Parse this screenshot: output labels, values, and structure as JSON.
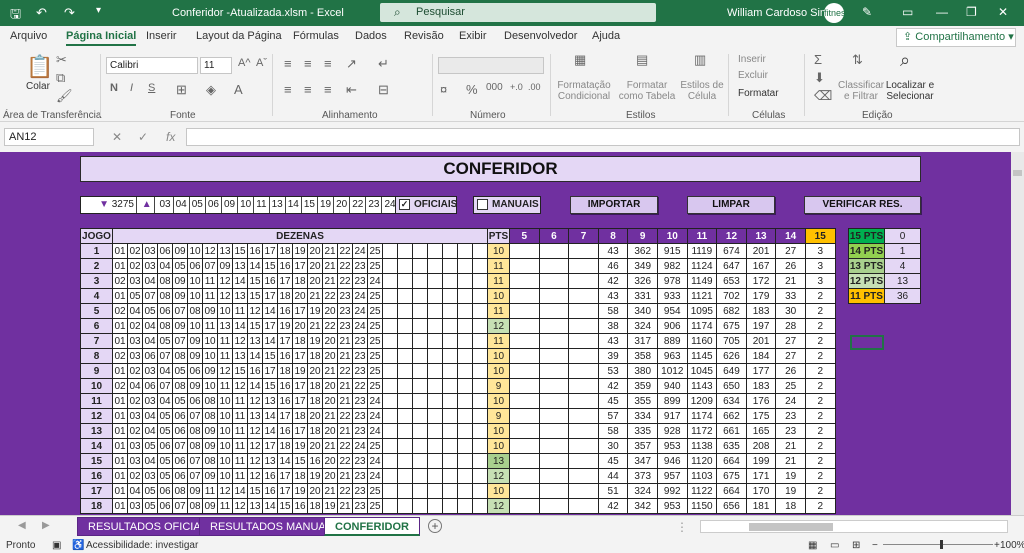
{
  "titlebar": {
    "file_title": "Conferidor -Atualizada.xlsm  -  Excel",
    "search_placeholder": "Pesquisar",
    "user_name": "William Cardoso Simas",
    "avatar_text": "fitness"
  },
  "menu": {
    "items": [
      "Arquivo",
      "Página Inicial",
      "Inserir",
      "Layout da Página",
      "Fórmulas",
      "Dados",
      "Revisão",
      "Exibir",
      "Desenvolvedor",
      "Ajuda"
    ],
    "share": "Compartilhamento"
  },
  "ribbon": {
    "paste_label": "Colar",
    "clipboard_group": "Área de Transferência",
    "font_name": "Calibri",
    "font_size": "11",
    "font_group": "Fonte",
    "bold": "N",
    "italic": "I",
    "underline": "S",
    "align_group": "Alinhamento",
    "number_group": "Número",
    "cond_format": "Formatação Condicional",
    "format_table": "Formatar como Tabela",
    "cell_styles": "Estilos de Célula",
    "styles_group": "Estilos",
    "insert": "Inserir",
    "delete": "Excluir",
    "format": "Formatar",
    "cells_group": "Células",
    "sort_filter": "Classificar e Filtrar",
    "find_select": "Localizar e Selecionar",
    "edit_group": "Edição"
  },
  "formula_bar": {
    "name_box": "AN12",
    "fx": "fx",
    "formula": ""
  },
  "sheet": {
    "banner": "CONFERIDOR",
    "draw_number": "3275",
    "draw_numbers": [
      "03",
      "04",
      "05",
      "06",
      "09",
      "10",
      "11",
      "13",
      "14",
      "15",
      "19",
      "20",
      "22",
      "23",
      "24"
    ],
    "chk_oficiais": "OFICIAIS",
    "chk_manuais": "MANUAIS",
    "btn_importar": "IMPORTAR",
    "btn_limpar": "LIMPAR",
    "btn_verificar": "VERIFICAR RES.",
    "headers": {
      "jogo": "JOGO",
      "dezenas": "DEZENAS",
      "pts": "PTS",
      "cols": [
        "5",
        "6",
        "7",
        "8",
        "9",
        "10",
        "11",
        "12",
        "13",
        "14",
        "15"
      ]
    },
    "rows": [
      {
        "jogo": "1",
        "d": [
          "01",
          "02",
          "03",
          "06",
          "09",
          "10",
          "12",
          "13",
          "15",
          "16",
          "17",
          "18",
          "19",
          "20",
          "21",
          "22",
          "24",
          "25"
        ],
        "pts": "10",
        "c": [
          "",
          "",
          "",
          "43",
          "362",
          "915",
          "1119",
          "674",
          "201",
          "27",
          "3"
        ]
      },
      {
        "jogo": "2",
        "d": [
          "01",
          "02",
          "03",
          "04",
          "05",
          "06",
          "07",
          "09",
          "13",
          "14",
          "15",
          "16",
          "17",
          "20",
          "21",
          "22",
          "23",
          "25"
        ],
        "pts": "11",
        "c": [
          "",
          "",
          "",
          "46",
          "349",
          "982",
          "1124",
          "647",
          "167",
          "26",
          "3"
        ]
      },
      {
        "jogo": "3",
        "d": [
          "02",
          "03",
          "04",
          "08",
          "09",
          "10",
          "11",
          "12",
          "14",
          "15",
          "16",
          "17",
          "18",
          "20",
          "21",
          "22",
          "23",
          "24"
        ],
        "pts": "11",
        "c": [
          "",
          "",
          "",
          "42",
          "326",
          "978",
          "1149",
          "653",
          "172",
          "21",
          "3"
        ]
      },
      {
        "jogo": "4",
        "d": [
          "01",
          "05",
          "07",
          "08",
          "09",
          "10",
          "11",
          "12",
          "13",
          "15",
          "17",
          "18",
          "20",
          "21",
          "22",
          "23",
          "24",
          "25"
        ],
        "pts": "10",
        "c": [
          "",
          "",
          "",
          "43",
          "331",
          "933",
          "1121",
          "702",
          "179",
          "33",
          "2"
        ]
      },
      {
        "jogo": "5",
        "d": [
          "02",
          "04",
          "05",
          "06",
          "07",
          "08",
          "09",
          "10",
          "11",
          "12",
          "14",
          "16",
          "17",
          "19",
          "20",
          "23",
          "24",
          "25"
        ],
        "pts": "11",
        "c": [
          "",
          "",
          "",
          "58",
          "340",
          "954",
          "1095",
          "682",
          "183",
          "30",
          "2"
        ]
      },
      {
        "jogo": "6",
        "d": [
          "01",
          "02",
          "04",
          "08",
          "09",
          "10",
          "11",
          "13",
          "14",
          "15",
          "17",
          "19",
          "20",
          "21",
          "22",
          "23",
          "24",
          "25"
        ],
        "pts": "12",
        "c": [
          "",
          "",
          "",
          "38",
          "324",
          "906",
          "1174",
          "675",
          "197",
          "28",
          "2"
        ]
      },
      {
        "jogo": "7",
        "d": [
          "01",
          "03",
          "04",
          "05",
          "07",
          "09",
          "10",
          "11",
          "12",
          "13",
          "14",
          "17",
          "18",
          "19",
          "20",
          "21",
          "23",
          "25"
        ],
        "pts": "11",
        "c": [
          "",
          "",
          "",
          "43",
          "317",
          "889",
          "1160",
          "705",
          "201",
          "27",
          "2"
        ]
      },
      {
        "jogo": "8",
        "d": [
          "02",
          "03",
          "06",
          "07",
          "08",
          "09",
          "10",
          "11",
          "13",
          "14",
          "15",
          "16",
          "17",
          "18",
          "20",
          "21",
          "23",
          "25"
        ],
        "pts": "10",
        "c": [
          "",
          "",
          "",
          "39",
          "358",
          "963",
          "1145",
          "626",
          "184",
          "27",
          "2"
        ]
      },
      {
        "jogo": "9",
        "d": [
          "01",
          "02",
          "03",
          "04",
          "05",
          "06",
          "09",
          "12",
          "15",
          "16",
          "17",
          "18",
          "19",
          "20",
          "21",
          "22",
          "23",
          "25"
        ],
        "pts": "10",
        "c": [
          "",
          "",
          "",
          "53",
          "380",
          "1012",
          "1045",
          "649",
          "177",
          "26",
          "2"
        ]
      },
      {
        "jogo": "10",
        "d": [
          "02",
          "04",
          "06",
          "07",
          "08",
          "09",
          "10",
          "11",
          "12",
          "14",
          "15",
          "16",
          "17",
          "18",
          "20",
          "21",
          "22",
          "25"
        ],
        "pts": "9",
        "c": [
          "",
          "",
          "",
          "42",
          "359",
          "940",
          "1143",
          "650",
          "183",
          "25",
          "2"
        ]
      },
      {
        "jogo": "11",
        "d": [
          "01",
          "02",
          "03",
          "04",
          "05",
          "06",
          "08",
          "10",
          "11",
          "12",
          "13",
          "16",
          "17",
          "18",
          "20",
          "21",
          "23",
          "24"
        ],
        "pts": "10",
        "c": [
          "",
          "",
          "",
          "45",
          "355",
          "899",
          "1209",
          "634",
          "176",
          "24",
          "2"
        ]
      },
      {
        "jogo": "12",
        "d": [
          "01",
          "03",
          "04",
          "05",
          "06",
          "07",
          "08",
          "10",
          "11",
          "13",
          "14",
          "17",
          "18",
          "20",
          "21",
          "22",
          "23",
          "24"
        ],
        "pts": "9",
        "c": [
          "",
          "",
          "",
          "57",
          "334",
          "917",
          "1174",
          "662",
          "175",
          "23",
          "2"
        ]
      },
      {
        "jogo": "13",
        "d": [
          "01",
          "02",
          "04",
          "05",
          "06",
          "08",
          "09",
          "10",
          "11",
          "12",
          "14",
          "16",
          "17",
          "18",
          "20",
          "21",
          "23",
          "24"
        ],
        "pts": "10",
        "c": [
          "",
          "",
          "",
          "58",
          "335",
          "928",
          "1172",
          "661",
          "165",
          "23",
          "2"
        ]
      },
      {
        "jogo": "14",
        "d": [
          "01",
          "03",
          "05",
          "06",
          "07",
          "08",
          "09",
          "10",
          "11",
          "12",
          "17",
          "18",
          "19",
          "20",
          "21",
          "22",
          "24",
          "25"
        ],
        "pts": "10",
        "c": [
          "",
          "",
          "",
          "30",
          "357",
          "953",
          "1138",
          "635",
          "208",
          "21",
          "2"
        ]
      },
      {
        "jogo": "15",
        "d": [
          "01",
          "03",
          "04",
          "05",
          "06",
          "07",
          "08",
          "10",
          "11",
          "12",
          "13",
          "14",
          "15",
          "16",
          "20",
          "22",
          "23",
          "24"
        ],
        "pts": "13",
        "c": [
          "",
          "",
          "",
          "45",
          "347",
          "946",
          "1120",
          "664",
          "199",
          "21",
          "2"
        ]
      },
      {
        "jogo": "16",
        "d": [
          "01",
          "02",
          "03",
          "05",
          "06",
          "07",
          "09",
          "10",
          "11",
          "12",
          "16",
          "17",
          "18",
          "19",
          "20",
          "21",
          "23",
          "24"
        ],
        "pts": "12",
        "c": [
          "",
          "",
          "",
          "44",
          "373",
          "957",
          "1103",
          "675",
          "171",
          "19",
          "2"
        ]
      },
      {
        "jogo": "17",
        "d": [
          "01",
          "04",
          "05",
          "06",
          "08",
          "09",
          "11",
          "12",
          "14",
          "15",
          "16",
          "17",
          "19",
          "20",
          "21",
          "22",
          "23",
          "25"
        ],
        "pts": "10",
        "c": [
          "",
          "",
          "",
          "51",
          "324",
          "992",
          "1122",
          "664",
          "170",
          "19",
          "2"
        ]
      },
      {
        "jogo": "18",
        "d": [
          "01",
          "03",
          "05",
          "06",
          "07",
          "08",
          "09",
          "11",
          "12",
          "13",
          "14",
          "15",
          "16",
          "18",
          "19",
          "21",
          "23",
          "25"
        ],
        "pts": "12",
        "c": [
          "",
          "",
          "",
          "42",
          "342",
          "953",
          "1150",
          "656",
          "181",
          "18",
          "2"
        ]
      }
    ],
    "summary": [
      {
        "label": "15 PTS",
        "value": "0",
        "color": "#00b050"
      },
      {
        "label": "14 PTS",
        "value": "1",
        "color": "#92d050"
      },
      {
        "label": "13 PTS",
        "value": "4",
        "color": "#a9d08e"
      },
      {
        "label": "12 PTS",
        "value": "13",
        "color": "#c6e0b4"
      },
      {
        "label": "11 PTS",
        "value": "36",
        "color": "#ffc000"
      }
    ]
  },
  "tabs": [
    "RESULTADOS OFICIAIS",
    "RESULTADOS MANUAIS",
    "CONFERIDOR"
  ],
  "status": {
    "ready": "Pronto",
    "accessibility": "Acessibilidade: investigar",
    "zoom": "100%"
  },
  "colors": {
    "excel_green": "#217346",
    "sheet_purple": "#7030a0",
    "lavender": "#e4d7f5",
    "pts_yellow": "#ffe699"
  }
}
